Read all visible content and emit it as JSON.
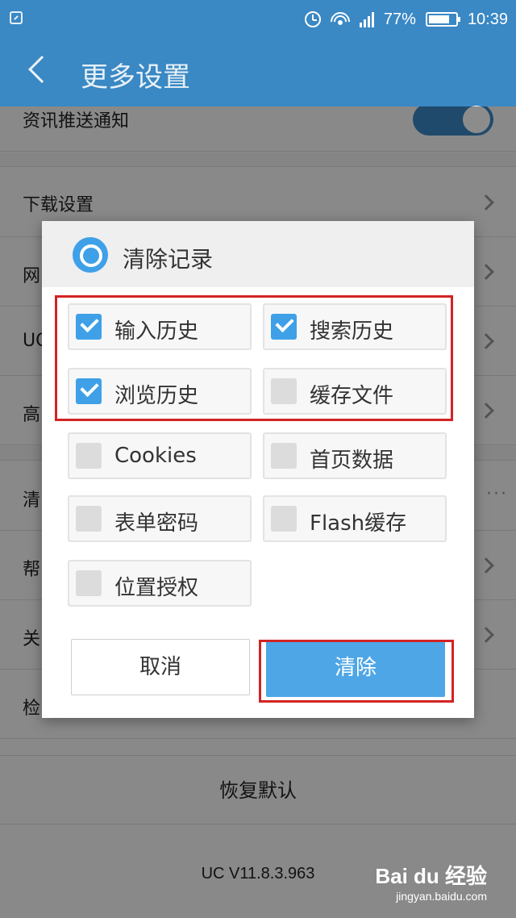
{
  "status_bar": {
    "battery": "77%",
    "battery_level_percent": 77,
    "time": "10:39"
  },
  "header": {
    "title": "更多设置"
  },
  "settings": {
    "push_notification_label": "资讯推送通知",
    "download_label": "下载设置",
    "row_net_partial": "网",
    "row_uc_partial": "UC",
    "row_advanced_partial": "高",
    "row_clear_partial": "清",
    "row_help_partial": "帮",
    "row_about_partial": "关",
    "row_check_partial": "检",
    "restore_default": "恢复默认",
    "version": "UC V11.8.3.963"
  },
  "dialog": {
    "title": "清除记录",
    "options": [
      {
        "label": "输入历史",
        "checked": true
      },
      {
        "label": "搜索历史",
        "checked": true
      },
      {
        "label": "浏览历史",
        "checked": true
      },
      {
        "label": "缓存文件",
        "checked": false
      },
      {
        "label": "Cookies",
        "checked": false
      },
      {
        "label": "首页数据",
        "checked": false
      },
      {
        "label": "表单密码",
        "checked": false
      },
      {
        "label": "Flash缓存",
        "checked": false
      },
      {
        "label": "位置授权",
        "checked": false
      }
    ],
    "cancel_label": "取消",
    "clear_label": "清除"
  },
  "watermark": {
    "brand": "Bai du 经验",
    "url": "jingyan.baidu.com"
  },
  "colors": {
    "accent": "#3a88c4",
    "checkbox_on": "#3fa0e8",
    "clear_button": "#4ea6e6",
    "highlight_box": "#d32323"
  }
}
